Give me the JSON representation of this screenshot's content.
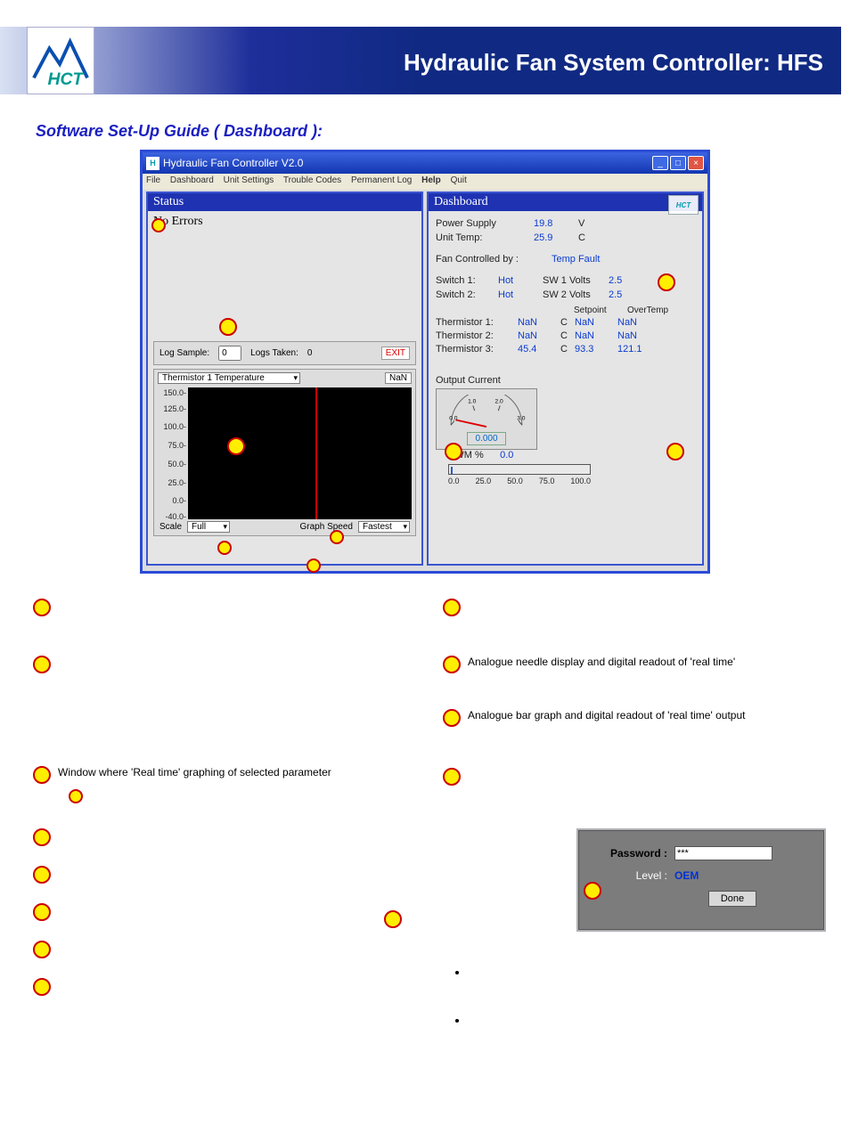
{
  "header": {
    "title": "Hydraulic Fan System Controller: HFS",
    "logo": "HCT"
  },
  "section_title": "Software Set-Up Guide ( Dashboard ):",
  "app": {
    "window_title": "Hydraulic Fan Controller V2.0",
    "menu": [
      "File",
      "Dashboard",
      "Unit Settings",
      "Trouble Codes",
      "Permanent Log",
      "Help",
      "Quit"
    ],
    "status_header": "Status",
    "status_text": "No Errors",
    "dashboard_header": "Dashboard",
    "logbar": {
      "log_sample_label": "Log Sample:",
      "log_sample_value": "0",
      "logs_taken_label": "Logs Taken:",
      "logs_taken_value": "0",
      "exit": "EXIT"
    },
    "graph": {
      "channel_selected": "Thermistor 1 Temperature",
      "nan_btn": "NaN",
      "y_ticks": [
        "150.0",
        "125.0",
        "100.0",
        "75.0",
        "50.0",
        "25.0",
        "0.0",
        "-40.0"
      ],
      "scale_label": "Scale",
      "scale_selected": "Full",
      "speed_label": "Graph Speed",
      "speed_selected": "Fastest"
    },
    "dash": {
      "power_supply_label": "Power Supply",
      "power_supply_val": "19.8",
      "power_supply_unit": "V",
      "unit_temp_label": "Unit Temp:",
      "unit_temp_val": "25.9",
      "unit_temp_unit": "C",
      "fan_by_label": "Fan Controlled by :",
      "fan_by_val": "Temp Fault",
      "sw1_label": "Switch 1:",
      "sw1_val": "Hot",
      "sw1v_label": "SW 1 Volts",
      "sw1v_val": "2.5",
      "sw2_label": "Switch 2:",
      "sw2_val": "Hot",
      "sw2v_label": "SW 2 Volts",
      "sw2v_val": "2.5",
      "setpoint_hdr": "Setpoint",
      "overtemp_hdr": "OverTemp",
      "therm": [
        {
          "label": "Thermistor 1:",
          "v": "NaN",
          "u": "C",
          "sp": "NaN",
          "ot": "NaN"
        },
        {
          "label": "Thermistor 2:",
          "v": "NaN",
          "u": "C",
          "sp": "NaN",
          "ot": "NaN"
        },
        {
          "label": "Thermistor 3:",
          "v": "45.4",
          "u": "C",
          "sp": "93.3",
          "ot": "121.1"
        }
      ],
      "output_label": "Output Current",
      "gauge": {
        "ticks": [
          "0.0",
          "1.0",
          "2.0",
          "3.0"
        ],
        "readout": "0.000"
      },
      "pwm_label": "PWM %",
      "pwm_val": "0.0",
      "pwm_ticks": [
        "0.0",
        "25.0",
        "50.0",
        "75.0",
        "100.0"
      ]
    }
  },
  "callouts": {
    "c1": "Analogue needle display and digital readout of 'real time'",
    "c2": "Analogue bar graph and digital readout of 'real time'  output",
    "c3": "Window where 'Real time' graphing of selected parameter"
  },
  "pw_dialog": {
    "password_label": "Password :",
    "password_value": "***",
    "level_label": "Level :",
    "level_value": "OEM",
    "done": "Done"
  }
}
